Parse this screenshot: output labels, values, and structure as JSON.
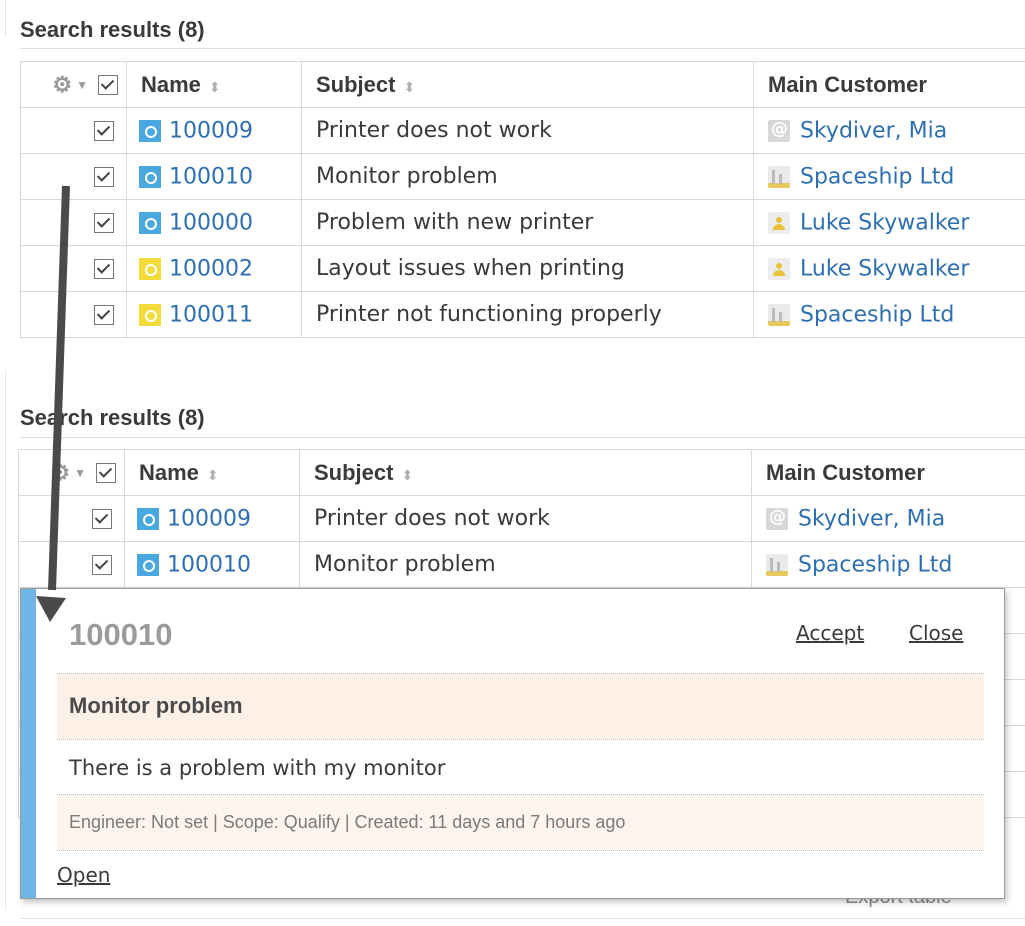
{
  "top": {
    "title": "Search results (8)",
    "headers": {
      "name": "Name",
      "subject": "Subject",
      "customer": "Main Customer"
    },
    "rows": [
      {
        "id": "100009",
        "icon": "blue",
        "subject": "Printer does not work",
        "customer": "Skydiver, Mia",
        "cust_icon": "email"
      },
      {
        "id": "100010",
        "icon": "blue",
        "subject": "Monitor problem",
        "customer": "Spaceship Ltd",
        "cust_icon": "company"
      },
      {
        "id": "100000",
        "icon": "blue",
        "subject": "Problem with new printer",
        "customer": "Luke Skywalker",
        "cust_icon": "person"
      },
      {
        "id": "100002",
        "icon": "yellow",
        "subject": "Layout issues when printing",
        "customer": "Luke Skywalker",
        "cust_icon": "person"
      },
      {
        "id": "100011",
        "icon": "yellow",
        "subject": "Printer not functioning properly",
        "customer": "Spaceship Ltd",
        "cust_icon": "company"
      }
    ]
  },
  "bottom": {
    "title": "Search results (8)",
    "headers": {
      "name": "Name",
      "subject": "Subject",
      "customer": "Main Customer"
    },
    "rows": [
      {
        "id": "100009",
        "icon": "blue",
        "subject": "Printer does not work",
        "customer": "Skydiver, Mia",
        "cust_icon": "email"
      },
      {
        "id": "100010",
        "icon": "blue",
        "subject": "Monitor problem",
        "customer": "Spaceship Ltd",
        "cust_icon": "company"
      }
    ]
  },
  "popup": {
    "id": "100010",
    "accept": "Accept",
    "close": "Close",
    "subject": "Monitor problem",
    "description": "There is a problem with my monitor",
    "meta": "Engineer: Not set | Scope: Qualify | Created: 11 days and 7 hours ago",
    "open": "Open"
  },
  "footer": {
    "export": "Export table"
  },
  "colors": {
    "accent_bar": "#6fb5e6",
    "link": "#2e6fb2",
    "highlight": "#fdf0e6"
  }
}
